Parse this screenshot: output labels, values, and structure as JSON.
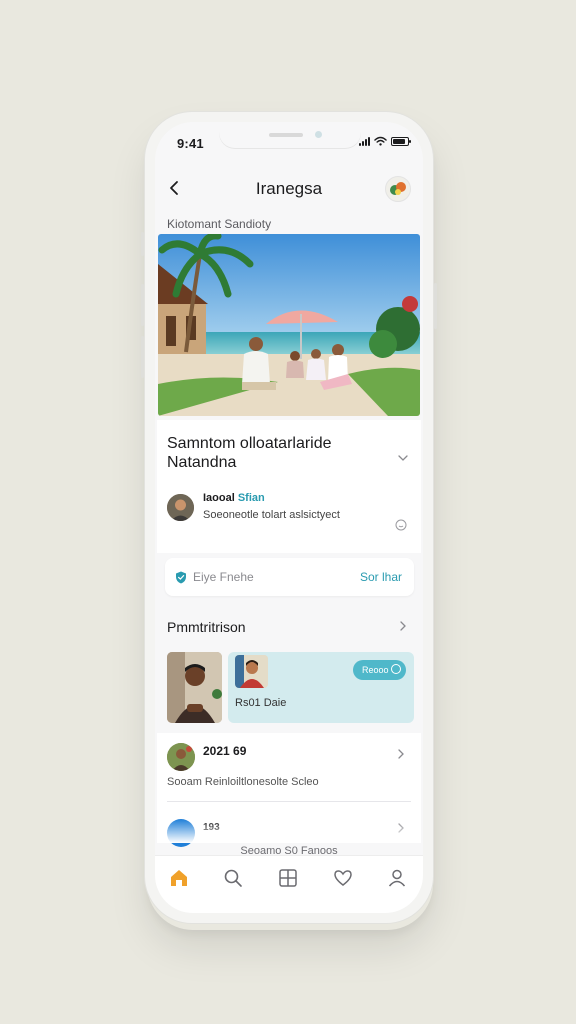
{
  "status_bar": {
    "time": "9:41"
  },
  "nav": {
    "title": "Iranegsa",
    "back_icon": "chevron-left-icon",
    "profile_icon": "avatar-icon"
  },
  "breadcrumb": "Kiotomant Sandioty",
  "hero_image": {
    "description_icon": "beach-photo"
  },
  "article": {
    "title_line1": "Samntom olloatarlaride",
    "title_line2": "Natandna",
    "author_prefix": "Iaooal ",
    "author_accent": "Sfian",
    "author_desc": "Soeoneotle tolart aslsictyect"
  },
  "search": {
    "placeholder": "Eiye Fnehe",
    "action_label": "Sor lhar"
  },
  "section": {
    "title": "Pmmtritrison"
  },
  "tiles": {
    "pill_label": "Reooo",
    "tile_label": "Rs01 Daie"
  },
  "list": {
    "row1_title": "2021 69",
    "row1_desc": "Sooam Reinloiltlonesolte Scleo",
    "row2_title": "193"
  },
  "footer_note": "Seoamo S0 Fanoos",
  "tabs": [
    "home-icon",
    "search-icon",
    "grid-icon",
    "heart-icon",
    "profile-icon"
  ],
  "colors": {
    "accent": "#2a9bb0",
    "tab_active": "#f0a12a",
    "tile_bg": "#d3ebee",
    "pill": "#4fb8ca"
  }
}
